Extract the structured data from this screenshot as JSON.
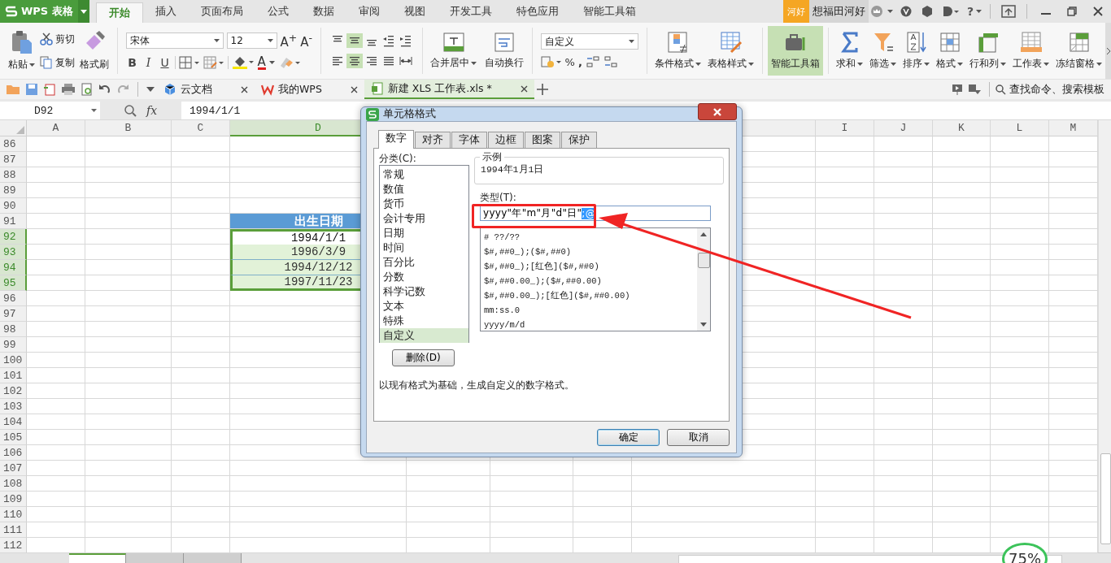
{
  "app": {
    "logo": "WPS 表格",
    "badge": "河好",
    "user": "想福田河好",
    "help": "?",
    "menu_tabs": [
      {
        "label": "开始",
        "selected": true
      },
      {
        "label": "插入",
        "selected": false
      },
      {
        "label": "页面布局",
        "selected": false
      },
      {
        "label": "公式",
        "selected": false
      },
      {
        "label": "数据",
        "selected": false
      },
      {
        "label": "审阅",
        "selected": false
      },
      {
        "label": "视图",
        "selected": false
      },
      {
        "label": "开发工具",
        "selected": false
      },
      {
        "label": "特色应用",
        "selected": false
      },
      {
        "label": "智能工具箱",
        "selected": false
      }
    ]
  },
  "ribbon": {
    "clipboard": {
      "paste": "粘贴",
      "cut": "剪切",
      "copy": "复制",
      "format_painter": "格式刷"
    },
    "font": {
      "name": "宋体",
      "size": "12",
      "grow": "A$^{+}$",
      "shrink": "A$^{-}$",
      "bold": "B",
      "italic": "I",
      "underline": "U",
      "font_color": "A"
    },
    "alignment": {
      "buttons": [
        {
          "kind": "top",
          "selected": false
        },
        {
          "kind": "middle",
          "selected": true
        },
        {
          "kind": "bottom",
          "selected": false
        },
        {
          "kind": "outdent",
          "selected": false
        },
        {
          "kind": "indent",
          "selected": false
        },
        {
          "kind": "left",
          "selected": false
        },
        {
          "kind": "center",
          "selected": true
        },
        {
          "kind": "right",
          "selected": false
        },
        {
          "kind": "justify",
          "selected": false
        },
        {
          "kind": "distributed",
          "selected": false
        }
      ],
      "merge": "合并居中",
      "wrap": "自动换行"
    },
    "number": {
      "format": "自定义",
      "percent": "%",
      "comma": ","
    },
    "tools": [
      {
        "label": "条件格式",
        "kind": "conditional",
        "selected": false,
        "dropdown": true
      },
      {
        "label": "表格样式",
        "kind": "table-style",
        "selected": false,
        "dropdown": true
      },
      {
        "label": "智能工具箱",
        "kind": "toolbox",
        "selected": true,
        "dropdown": false
      },
      {
        "label": "求和",
        "kind": "sum",
        "selected": false,
        "dropdown": true
      },
      {
        "label": "筛选",
        "kind": "filter",
        "selected": false,
        "dropdown": true
      },
      {
        "label": "排序",
        "kind": "sort",
        "selected": false,
        "dropdown": true
      },
      {
        "label": "格式",
        "kind": "format",
        "selected": false,
        "dropdown": true
      },
      {
        "label": "行和列",
        "kind": "rows-cols",
        "selected": false,
        "dropdown": true
      },
      {
        "label": "工作表",
        "kind": "sheet",
        "selected": false,
        "dropdown": true
      },
      {
        "label": "冻结窗格",
        "kind": "freeze",
        "selected": false,
        "dropdown": true
      }
    ]
  },
  "doc_tabs": [
    {
      "label": "云文档",
      "kind": "cloud",
      "selected": false
    },
    {
      "label": "我的WPS",
      "kind": "wps",
      "selected": false
    },
    {
      "label": "新建 XLS 工作表.xls *",
      "kind": "sheet",
      "selected": true
    }
  ],
  "search": "查找命令、搜索模板",
  "formula_bar": {
    "cell": "D92",
    "fx": "fx",
    "value": "1994/1/1"
  },
  "sheet": {
    "columns_left": [
      {
        "label": "A",
        "selected": false
      },
      {
        "label": "B",
        "selected": false
      },
      {
        "label": "C",
        "selected": false
      },
      {
        "label": "D",
        "selected": true
      }
    ],
    "columns_right": [
      {
        "label": "I",
        "selected": false
      },
      {
        "label": "J",
        "selected": false
      },
      {
        "label": "K",
        "selected": false
      },
      {
        "label": "L",
        "selected": false
      },
      {
        "label": "M",
        "selected": false
      }
    ],
    "rows": [
      {
        "number": "86",
        "selected": false
      },
      {
        "number": "87",
        "selected": false
      },
      {
        "number": "88",
        "selected": false
      },
      {
        "number": "89",
        "selected": false
      },
      {
        "number": "90",
        "selected": false
      },
      {
        "number": "91",
        "selected": false,
        "d": {
          "text": "出生日期",
          "kind": "header"
        }
      },
      {
        "number": "92",
        "selected": true,
        "d": {
          "text": "1994/1/1",
          "kind": "active"
        }
      },
      {
        "number": "93",
        "selected": true,
        "d": {
          "text": "1996/3/9",
          "kind": "range"
        }
      },
      {
        "number": "94",
        "selected": true,
        "d": {
          "text": "1994/12/12",
          "kind": "range"
        }
      },
      {
        "number": "95",
        "selected": true,
        "d": {
          "text": "1997/11/23",
          "kind": "range"
        }
      },
      {
        "number": "96",
        "selected": false
      },
      {
        "number": "97",
        "selected": false
      },
      {
        "number": "98",
        "selected": false
      },
      {
        "number": "99",
        "selected": false
      },
      {
        "number": "100",
        "selected": false
      },
      {
        "number": "101",
        "selected": false
      },
      {
        "number": "102",
        "selected": false
      },
      {
        "number": "103",
        "selected": false
      },
      {
        "number": "104",
        "selected": false
      },
      {
        "number": "105",
        "selected": false
      },
      {
        "number": "106",
        "selected": false
      },
      {
        "number": "107",
        "selected": false
      },
      {
        "number": "108",
        "selected": false
      },
      {
        "number": "109",
        "selected": false
      },
      {
        "number": "110",
        "selected": false
      },
      {
        "number": "111",
        "selected": false
      },
      {
        "number": "112",
        "selected": false
      }
    ]
  },
  "dialog": {
    "title": "单元格格式",
    "tabs": [
      {
        "label": "数字",
        "selected": true
      },
      {
        "label": "对齐",
        "selected": false
      },
      {
        "label": "字体",
        "selected": false
      },
      {
        "label": "边框",
        "selected": false
      },
      {
        "label": "图案",
        "selected": false
      },
      {
        "label": "保护",
        "selected": false
      }
    ],
    "category_label": "分类(C):",
    "categories": [
      {
        "label": "常规",
        "selected": false
      },
      {
        "label": "数值",
        "selected": false
      },
      {
        "label": "货币",
        "selected": false
      },
      {
        "label": "会计专用",
        "selected": false
      },
      {
        "label": "日期",
        "selected": false
      },
      {
        "label": "时间",
        "selected": false
      },
      {
        "label": "百分比",
        "selected": false
      },
      {
        "label": "分数",
        "selected": false
      },
      {
        "label": "科学记数",
        "selected": false
      },
      {
        "label": "文本",
        "selected": false
      },
      {
        "label": "特殊",
        "selected": false
      },
      {
        "label": "自定义",
        "selected": true
      }
    ],
    "sample_legend": "示例",
    "sample": "1994年1月1日",
    "type_label": "类型(T):",
    "type_value": "yyyy\"年\"m\"月\"d\"日\"",
    "type_selection": ";@",
    "formats": [
      "# ??/??",
      "$#,##0_);($#,##0)",
      "$#,##0_);[红色]($#,##0)",
      "$#,##0.00_);($#,##0.00)",
      "$#,##0.00_);[红色]($#,##0.00)",
      "mm:ss.0",
      "yyyy/m/d"
    ],
    "delete": "删除(D)",
    "description": "以现有格式为基础，生成自定义的数字格式。",
    "ok": "确定",
    "cancel": "取消"
  },
  "sheet_tabs": [
    {
      "selected": true
    },
    {
      "selected": false
    },
    {
      "selected": false
    }
  ],
  "zoom": "75%"
}
